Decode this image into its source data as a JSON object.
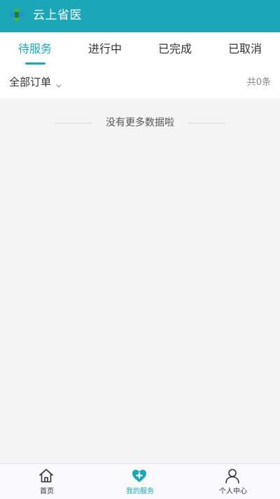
{
  "header": {
    "title": "云上省医",
    "logo_icon": "cross-logo-icon"
  },
  "tabs": [
    {
      "label": "待服务",
      "active": true
    },
    {
      "label": "进行中",
      "active": false
    },
    {
      "label": "已完成",
      "active": false
    },
    {
      "label": "已取消",
      "active": false
    }
  ],
  "filter": {
    "label": "全部订单",
    "count_text": "共0条"
  },
  "list": {
    "empty_text": "没有更多数据啦"
  },
  "bottom_nav": [
    {
      "label": "首页",
      "icon": "home-icon",
      "active": false
    },
    {
      "label": "我的服务",
      "icon": "heart-plus-icon",
      "active": true
    },
    {
      "label": "个人中心",
      "icon": "user-icon",
      "active": false
    }
  ],
  "colors": {
    "accent": "#1ba7b7",
    "background": "#f4f4f5"
  }
}
